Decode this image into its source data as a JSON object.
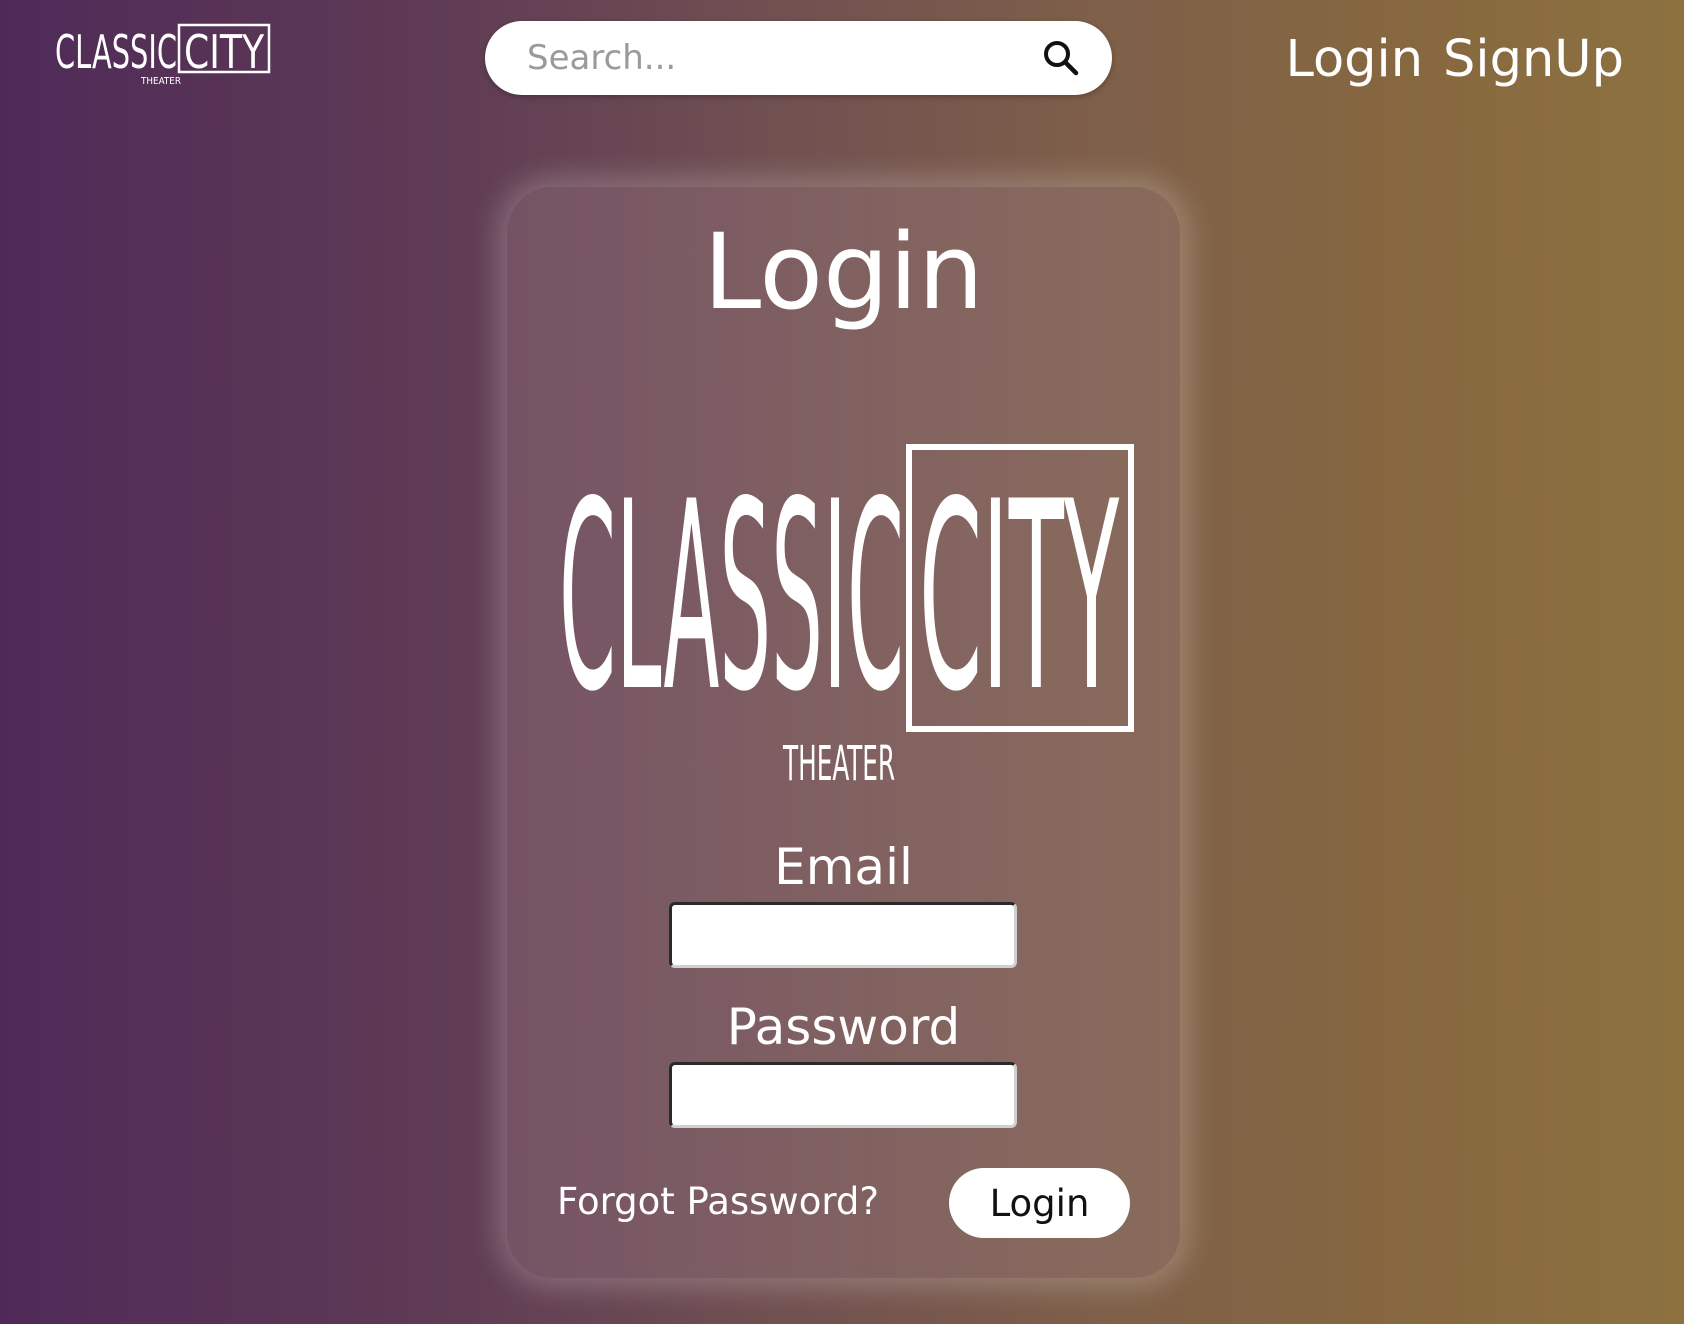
{
  "brand": {
    "word1": "CLASSIC",
    "word2": "CITY",
    "sub": "THEATER"
  },
  "search": {
    "placeholder": "Search...",
    "icon": "search-icon"
  },
  "nav": {
    "login_label": "Login",
    "signup_label": "SignUp"
  },
  "login_card": {
    "title": "Login",
    "logo": {
      "word1": "CLASSIC",
      "word2": "CITY",
      "sub": "THEATER"
    },
    "email_label": "Email",
    "email_value": "",
    "password_label": "Password",
    "password_value": "",
    "forgot_label": "Forgot Password?",
    "submit_label": "Login"
  },
  "colors": {
    "gradient_left": "#4f2a58",
    "gradient_right": "#8d7240",
    "text": "#ffffff"
  }
}
